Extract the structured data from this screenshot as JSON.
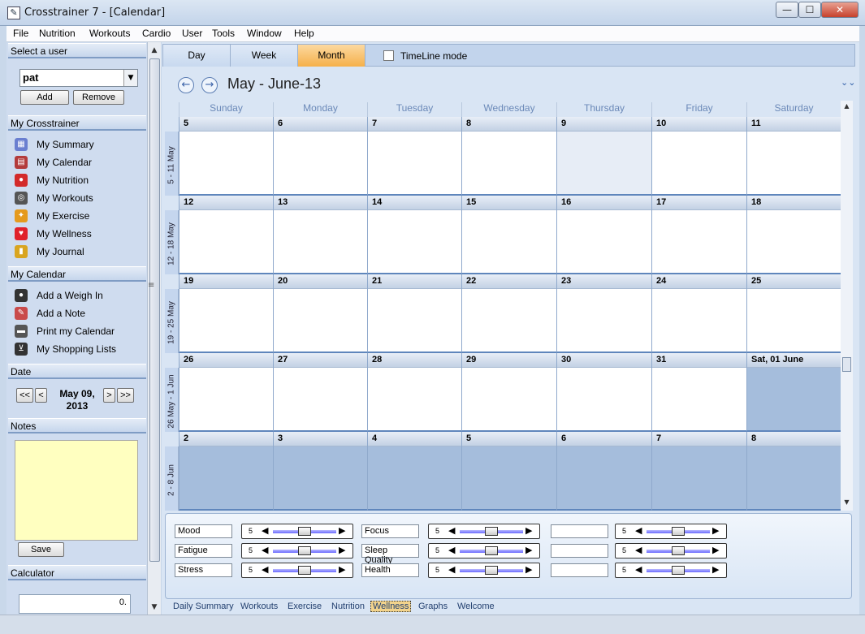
{
  "window": {
    "title": "Crosstrainer 7 - [Calendar]",
    "min": "—",
    "max": "☐",
    "close": "✕"
  },
  "menu": [
    "File",
    "Nutrition",
    "Workouts",
    "Cardio",
    "User",
    "Tools",
    "Window",
    "Help"
  ],
  "sidebar": {
    "select_user_header": "Select a user",
    "user_value": "pat",
    "add_label": "Add",
    "remove_label": "Remove",
    "crosstrainer_header": "My Crosstrainer",
    "crosstrainer_items": [
      {
        "label": "My Summary",
        "icon": "summary-icon",
        "color": "#6a7fd0"
      },
      {
        "label": "My Calendar",
        "icon": "calendar-icon",
        "color": "#b33b3b"
      },
      {
        "label": "My Nutrition",
        "icon": "apple-icon",
        "color": "#d32a2a"
      },
      {
        "label": "My Workouts",
        "icon": "workouts-icon",
        "color": "#555555"
      },
      {
        "label": "My Exercise",
        "icon": "exercise-icon",
        "color": "#e59a1d"
      },
      {
        "label": "My Wellness",
        "icon": "heart-icon",
        "color": "#e0202a"
      },
      {
        "label": "My Journal",
        "icon": "journal-icon",
        "color": "#d9a520"
      }
    ],
    "calendar_header": "My Calendar",
    "calendar_items": [
      {
        "label": "Add a Weigh In",
        "icon": "scale-icon",
        "color": "#333333"
      },
      {
        "label": "Add a Note",
        "icon": "note-icon",
        "color": "#c94a4a"
      },
      {
        "label": "Print my Calendar",
        "icon": "printer-icon",
        "color": "#555555"
      },
      {
        "label": "My Shopping Lists",
        "icon": "cart-icon",
        "color": "#333333"
      }
    ],
    "date_header": "Date",
    "date_prev2": "<<",
    "date_prev": "<",
    "date_next": ">",
    "date_next2": ">>",
    "date_line1": "May 09,",
    "date_line2": "2013",
    "notes_header": "Notes",
    "save_label": "Save",
    "calculator_header": "Calculator",
    "calculator_value": "0."
  },
  "view_tabs": {
    "tabs": [
      "Day",
      "Week",
      "Month"
    ],
    "active": "Month",
    "timeline_label": "TimeLine mode"
  },
  "calendar": {
    "period": "May - June-13",
    "day_names": [
      "Sunday",
      "Monday",
      "Tuesday",
      "Wednesday",
      "Thursday",
      "Friday",
      "Saturday"
    ],
    "weeks": [
      {
        "label": "5 - 11 May",
        "days": [
          "5",
          "6",
          "7",
          "8",
          "9",
          "10",
          "11"
        ]
      },
      {
        "label": "12 - 18 May",
        "days": [
          "12",
          "13",
          "14",
          "15",
          "16",
          "17",
          "18"
        ]
      },
      {
        "label": "19 - 25 May",
        "days": [
          "19",
          "20",
          "21",
          "22",
          "23",
          "24",
          "25"
        ]
      },
      {
        "label": "26 May - 1 Jun",
        "days": [
          "26",
          "27",
          "28",
          "29",
          "30",
          "31",
          "Sat, 01 June"
        ]
      },
      {
        "label": "2 - 8 Jun",
        "days": [
          "2",
          "3",
          "4",
          "5",
          "6",
          "7",
          "8"
        ]
      }
    ]
  },
  "wellness": {
    "rows": [
      [
        {
          "label": "Mood",
          "value": 5
        },
        {
          "label": "Focus",
          "value": 5
        },
        {
          "label": "",
          "value": 5
        }
      ],
      [
        {
          "label": "Fatigue",
          "value": 5
        },
        {
          "label": "Sleep Quality",
          "value": 5
        },
        {
          "label": "",
          "value": 5
        }
      ],
      [
        {
          "label": "Stress",
          "value": 5
        },
        {
          "label": "Health",
          "value": 5
        },
        {
          "label": "",
          "value": 5
        }
      ]
    ]
  },
  "bottom_tabs": {
    "tabs": [
      "Daily Summary",
      "Workouts",
      "Exercise",
      "Nutrition",
      "Wellness",
      "Graphs",
      "Welcome"
    ],
    "active": "Wellness"
  }
}
